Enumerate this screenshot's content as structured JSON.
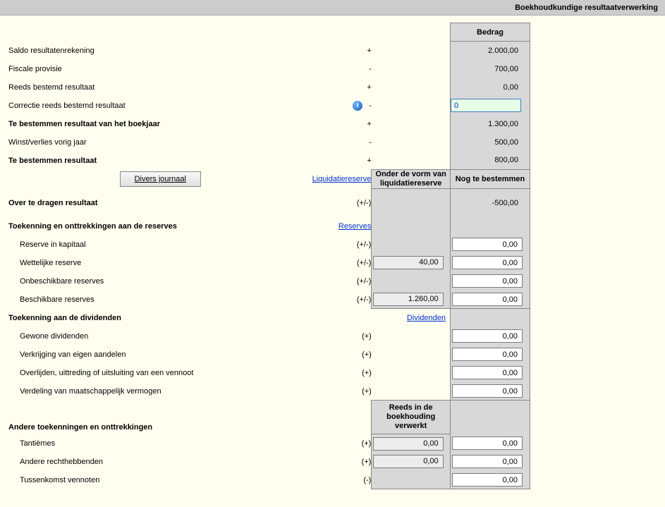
{
  "titlebar": "Boekhoudkundige resultaatverwerking",
  "headers": {
    "bedrag": "Bedrag",
    "onder_vorm": "Onder de vorm van liquidatiereserve",
    "nog_bestemmen": "Nog te bestemmen",
    "reeds_verwerkt": "Reeds in de boekhouding verwerkt"
  },
  "rows": {
    "saldo": {
      "label": "Saldo resultatenrekening",
      "sign": "+",
      "value": "2.000,00"
    },
    "fiscale": {
      "label": "Fiscale provisie",
      "sign": "-",
      "value": "700,00"
    },
    "reeds": {
      "label": "Reeds bestemd resultaat",
      "sign": "+",
      "value": "0,00"
    },
    "correctie": {
      "label": "Correctie reeds bestemd resultaat",
      "sign": "-",
      "value": "0"
    },
    "te_best_jaar": {
      "label": "Te bestemmen resultaat van het boekjaar",
      "sign": "+",
      "value": "1.300,00"
    },
    "winst_verlies": {
      "label": "Winst/verlies vorig jaar",
      "sign": "-",
      "value": "500,00"
    },
    "te_best": {
      "label": "Te bestemmen resultaat",
      "sign": "+",
      "value": "800,00"
    },
    "over_dragen": {
      "label": "Over te dragen resultaat",
      "sign": "(+/-)",
      "value": "-500,00"
    }
  },
  "links": {
    "divers": "Divers journaal",
    "liquidatie": "Liquidatiereserve",
    "reserves": "Reserves",
    "dividenden": "Dividenden"
  },
  "sections": {
    "toekenning_reserves": "Toekenning en onttrekkingen aan de reserves",
    "toekenning_div": "Toekenning aan de dividenden",
    "andere": "Andere toekenningen en onttrekkingen"
  },
  "reserves": {
    "kapitaal": {
      "label": "Reserve in kapitaal",
      "sign": "(+/-)",
      "mid": "",
      "val": "0,00"
    },
    "wettelijke": {
      "label": "Wettelijke reserve",
      "sign": "(+/-)",
      "mid": "40,00",
      "val": "0,00"
    },
    "onbeschikbare": {
      "label": "Onbeschikbare reserves",
      "sign": "(+/-)",
      "mid": "",
      "val": "0,00"
    },
    "beschikbare": {
      "label": "Beschikbare reserves",
      "sign": "(+/-)",
      "mid": "1.260,00",
      "val": "0,00"
    }
  },
  "dividenden": {
    "gewone": {
      "label": "Gewone dividenden",
      "sign": "(+)",
      "val": "0,00"
    },
    "verkrijging": {
      "label": "Verkrijging van eigen aandelen",
      "sign": "(+)",
      "val": "0,00"
    },
    "overlijden": {
      "label": "Overlijden, uittreding of uitsluiting van een vennoot",
      "sign": "(+)",
      "val": "0,00"
    },
    "verdeling": {
      "label": "Verdeling van maatschappelijk vermogen",
      "sign": "(+)",
      "val": "0,00"
    }
  },
  "andere": {
    "tantiemes": {
      "label": "Tantièmes",
      "sign": "(+)",
      "mid": "0,00",
      "val": "0,00"
    },
    "rechth": {
      "label": "Andere rechthebbenden",
      "sign": "(+)",
      "mid": "0,00",
      "val": "0,00"
    },
    "tussenkomst": {
      "label": "Tussenkomst vennoten",
      "sign": "(-)",
      "mid": "",
      "val": "0,00"
    }
  }
}
